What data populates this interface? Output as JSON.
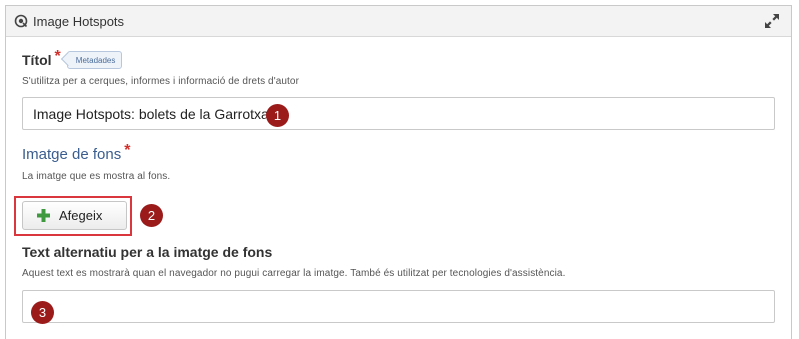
{
  "panel": {
    "title": "Image Hotspots",
    "header_icon": "hotspot-icon",
    "expand_icon": "expand-arrows-icon"
  },
  "title_field": {
    "label": "Títol",
    "required_mark": "*",
    "tag": "Metadades",
    "description": "S'utilitza per a cerques, informes i informació de drets d'autor",
    "value": "Image Hotspots: bolets de la Garrotxa"
  },
  "background_image": {
    "label": "Imatge de fons",
    "required_mark": "*",
    "description": "La imatge que es mostra al fons.",
    "add_button": "Afegeix",
    "add_icon": "plus-icon"
  },
  "alt_text_field": {
    "label": "Text alternatiu per a la imatge de fons",
    "description": "Aquest text es mostrarà quan el navegador no pugui carregar la imatge. També és utilitzat per tecnologies d'assistència.",
    "value": ""
  },
  "markers": [
    "1",
    "2",
    "3"
  ],
  "colors": {
    "marker": "#9b1b1b",
    "required": "#d0312d",
    "highlight": "#d9363e",
    "plus": "#3f9a3f",
    "section_label": "#3a5d8f"
  }
}
